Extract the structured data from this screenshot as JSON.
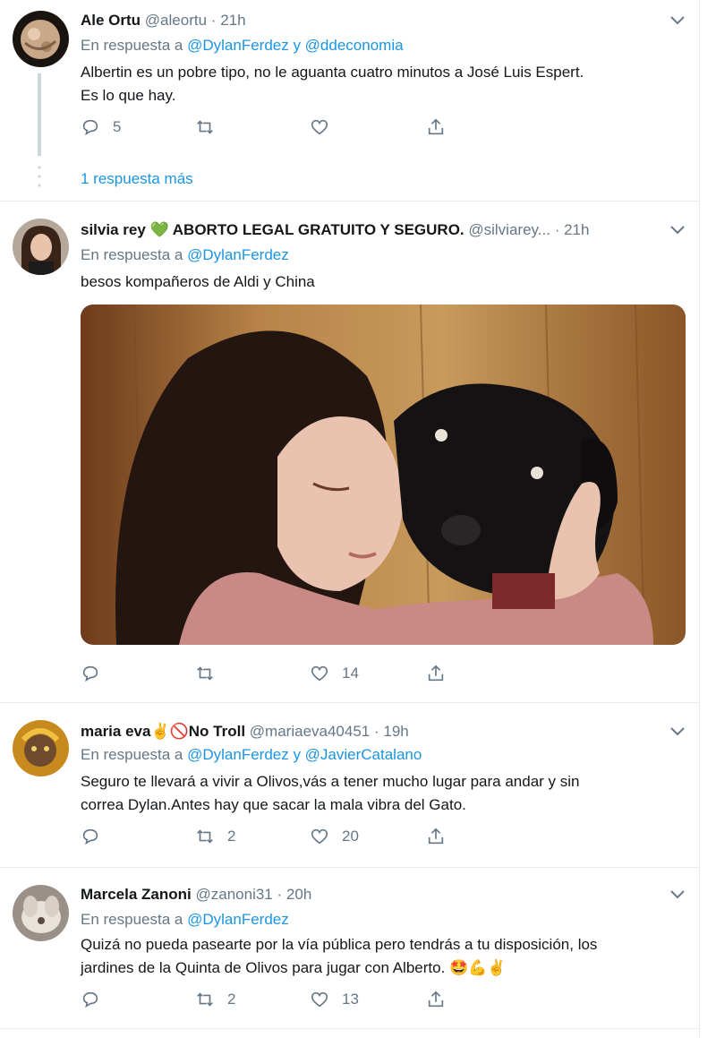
{
  "tweets": [
    {
      "name": "Ale Ortu",
      "handle": "@aleortu",
      "dot": "·",
      "time": "21h",
      "reply_prefix": "En respuesta a",
      "reply_to": "@DylanFerdez y @ddeconomia",
      "text_lines": [
        "Albertin es un pobre tipo, no le aguanta cuatro minutos a José Luis Espert.",
        "Es lo que hay."
      ],
      "replies": "5",
      "retweets": "",
      "likes": "",
      "more_replies": "1 respuesta más"
    },
    {
      "name": "silvia rey 💚 ABORTO LEGAL GRATUITO Y SEGURO.",
      "handle": "@silviarey...",
      "dot": "·",
      "time": "21h",
      "reply_prefix": "En respuesta a",
      "reply_to": "@DylanFerdez",
      "text_lines": [
        "besos kompañeros de Aldi y China"
      ],
      "replies": "",
      "retweets": "",
      "likes": "14",
      "media": "photo of a woman hugging a black dog"
    },
    {
      "name": "maria eva✌🚫No Troll",
      "handle": "@mariaeva40451",
      "dot": "·",
      "time": "19h",
      "reply_prefix": "En respuesta a",
      "reply_to": "@DylanFerdez y @JavierCatalano",
      "text_lines": [
        "Seguro te llevará a vivir a Olivos,vás a tener mucho lugar para andar y sin",
        "correa Dylan.Antes hay que sacar la mala vibra del Gato."
      ],
      "replies": "",
      "retweets": "2",
      "likes": "20"
    },
    {
      "name": "Marcela Zanoni",
      "handle": "@zanoni31",
      "dot": "·",
      "time": "20h",
      "reply_prefix": "En respuesta a",
      "reply_to": "@DylanFerdez",
      "text_lines": [
        "Quizá no pueda pasearte por la vía pública pero tendrás a tu disposición, los",
        "jardines de la Quinta de Olivos para jugar con Alberto. 🤩💪✌"
      ],
      "replies": "",
      "retweets": "2",
      "likes": "13"
    }
  ],
  "icons": {
    "reply": "reply-icon",
    "retweet": "retweet-icon",
    "like": "heart-icon",
    "share": "share-icon",
    "menu": "chevron-down-icon"
  },
  "colors": {
    "link": "#1b95e0",
    "muted": "#657786",
    "line": "#ccd6dd"
  }
}
